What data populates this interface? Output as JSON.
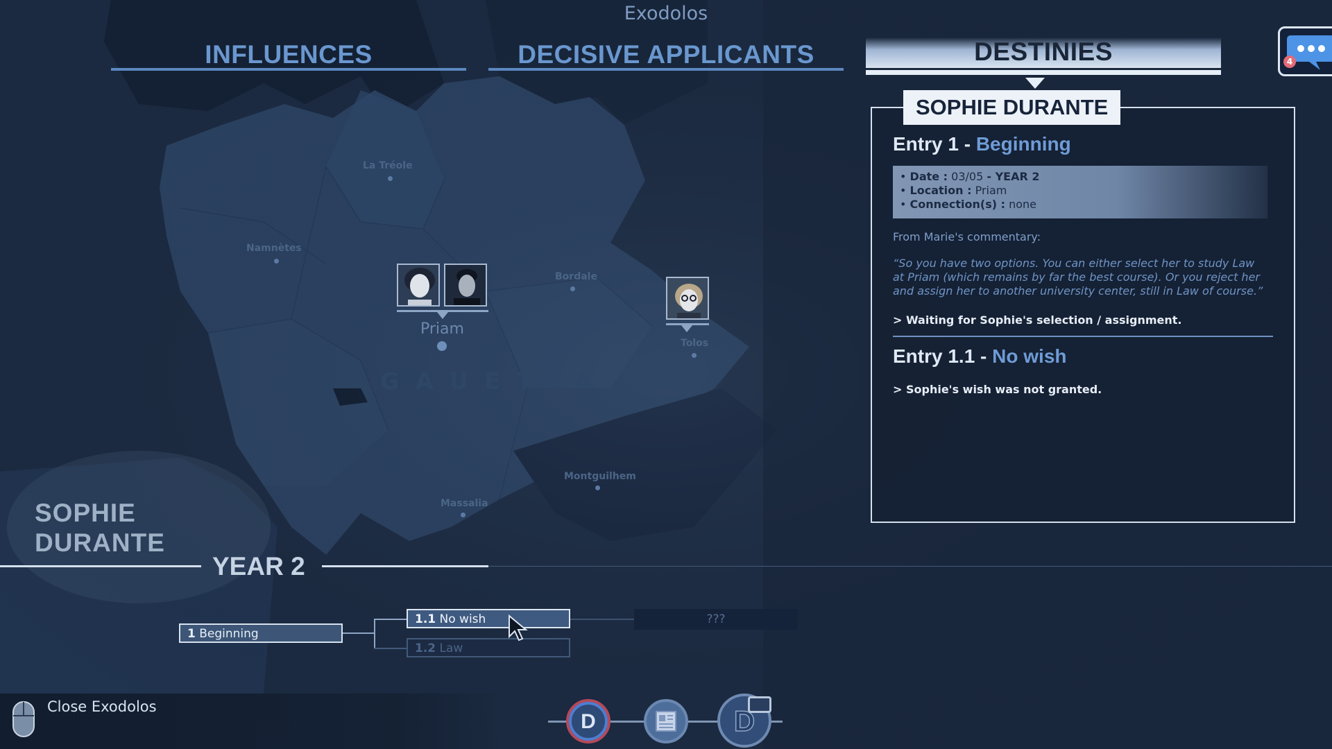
{
  "app_title": "Exodolos",
  "tabs": [
    {
      "label": "INFLUENCES",
      "active": false
    },
    {
      "label": "DECISIVE APPLICANTS",
      "active": false
    },
    {
      "label": "DESTINIES",
      "active": true
    }
  ],
  "chat": {
    "icon": "chat-bubble-icon",
    "badge": "4"
  },
  "map": {
    "cities": [
      "La Tréole",
      "Namnètes",
      "Bordale",
      "Tolos",
      "Montguilhem",
      "Massalia"
    ],
    "selected_city": "Priam",
    "region": "GAUETIA"
  },
  "destiny": {
    "name": "SOPHIE DURANTE",
    "entry1": {
      "prefix": "Entry 1 - ",
      "title": "Beginning",
      "date_label": "Date :",
      "date_value": " 03/05 ",
      "date_year": "- YEAR 2",
      "location_label": "Location :",
      "location_value": " Priam",
      "connections_label": "Connection(s) :",
      "connections_value": " none",
      "commentary_label": "From Marie's commentary:",
      "quote": "“So you have two options. You can either select her to study Law at Priam (which remains by far the best course). Or you reject her and assign her to another university center, still in Law of course.”",
      "note": "> Waiting for Sophie's selection / assignment."
    },
    "entry2": {
      "prefix": "Entry 1.1 - ",
      "title": "No wish",
      "note": "> Sophie's wish was not granted."
    }
  },
  "character": {
    "first_name": "SOPHIE",
    "last_name": "DURANTE"
  },
  "timeline": {
    "year": "YEAR 2",
    "nodes": {
      "beginning": {
        "num": "1",
        "label": " Beginning"
      },
      "nowish": {
        "num": "1.1",
        "label": " No wish"
      },
      "law": {
        "num": "1.2",
        "label": " Law"
      },
      "unknown": "???"
    }
  },
  "footer": {
    "close_label": "Close Exodolos"
  },
  "colors": {
    "accent": "#6f9cd6",
    "background": "#1c2d44",
    "panel": "#152134"
  }
}
